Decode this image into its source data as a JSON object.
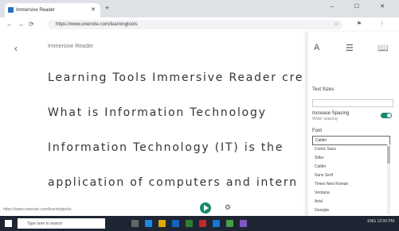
{
  "browser": {
    "tab_title": "Immersive Reader",
    "new_tab": "+",
    "window_controls": "– ☐ ✕",
    "url": "https://www.onenote.com/learningtools",
    "nav": [
      "←",
      "→",
      "⟳",
      "⌂"
    ],
    "right_icons": "☆ ⚑ ⋮"
  },
  "reader": {
    "title": "Immersive Reader",
    "lines": [
      "Learning Tools Immersive Reader cre",
      "What is Information Technology",
      "Information Technology (IT) is the",
      "application of computers and intern"
    ]
  },
  "panel": {
    "icons": [
      "A",
      "☰",
      "📖"
    ],
    "text_size": "Text Sizes",
    "focus_label": "Increase Spacing",
    "focus_sub": "Wider spacing",
    "font_label": "Font",
    "font_selected": "Calibri",
    "font_options": [
      "Comic Sans",
      "Sitka",
      "Calibri",
      "Sans Serif",
      "Times New Roman",
      "Verdana",
      "Arial",
      "Georgia"
    ]
  },
  "status_text": "https://www.onenote.com/learningtools",
  "taskbar": {
    "search_placeholder": "Type here to search",
    "tray": "ENG 12:00 PM"
  }
}
